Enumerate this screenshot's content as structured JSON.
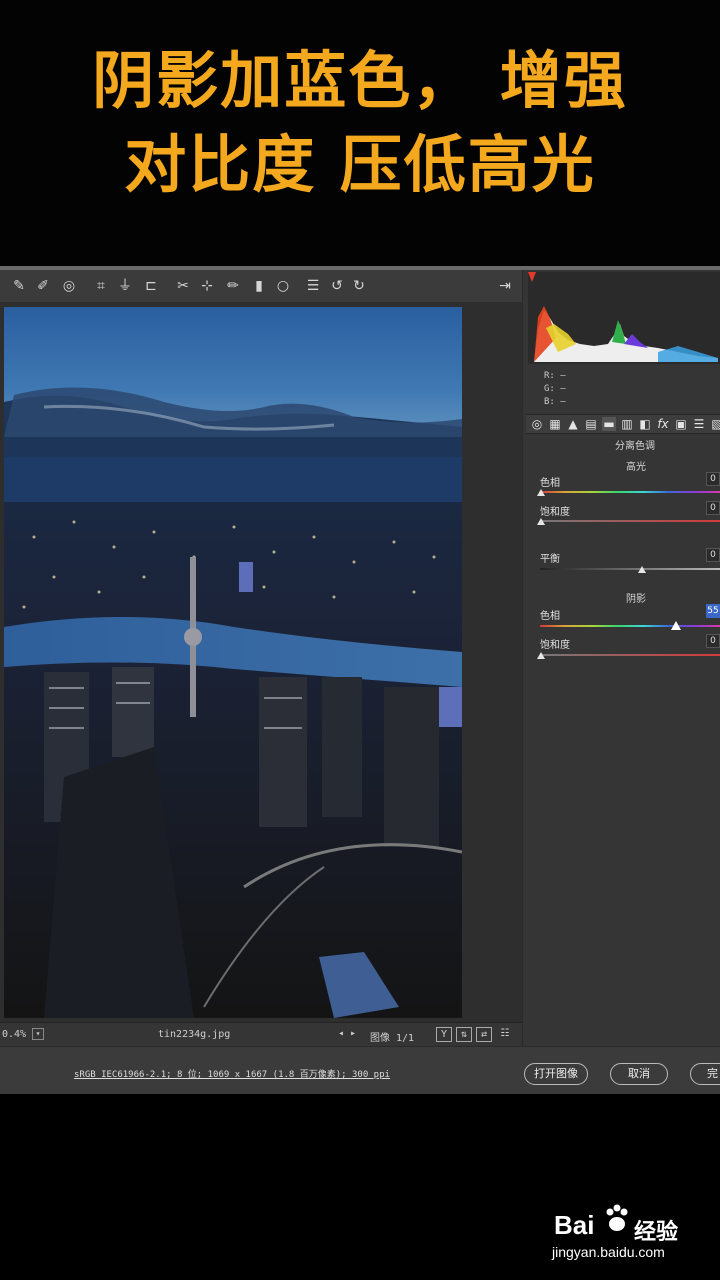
{
  "caption": {
    "line1": "阴影加蓝色， 增强",
    "line2": "对比度 压低高光"
  },
  "toolbar": {
    "icons": [
      "eyedropper-icon",
      "color-sampler-icon",
      "target-adjust-icon",
      "crop-icon",
      "straighten-icon",
      "transform-icon",
      "spot-removal-icon",
      "redeye-icon",
      "brush-icon",
      "graduated-filter-icon",
      "radial-filter-icon",
      "list-icon",
      "rotate-left-icon",
      "rotate-right-icon"
    ],
    "export_icon": "export-icon"
  },
  "histogram": {
    "r": "—",
    "g": "—",
    "b": "—",
    "r_label": "R:",
    "g_label": "G:",
    "b_label": "B:"
  },
  "panel": {
    "section_title": "分离色调",
    "highlights": {
      "title": "高光",
      "hue_label": "色相",
      "hue_value": "0",
      "saturation_label": "饱和度",
      "saturation_value": "0"
    },
    "balance": {
      "label": "平衡",
      "value": "0"
    },
    "shadows": {
      "title": "阴影",
      "hue_label": "色相",
      "hue_value": "55",
      "saturation_label": "饱和度",
      "saturation_value": "0"
    }
  },
  "status": {
    "zoom": "0.4%",
    "filename": "tin2234g.jpg",
    "image_count": "图像 1/1"
  },
  "footer": {
    "info": "sRGB IEC61966-2.1; 8 位; 1069 x 1667 (1.8 百万像素); 300 ppi",
    "open_button": "打开图像",
    "cancel_button": "取消",
    "done_button": "完"
  },
  "watermark": {
    "brand": "Bai",
    "brand2": "经验",
    "url": "jingyan.baidu.com"
  },
  "colors": {
    "caption": "#f4a81d",
    "bg": "#3b3b3b",
    "panel": "#353535",
    "selected": "#3a68c4"
  }
}
